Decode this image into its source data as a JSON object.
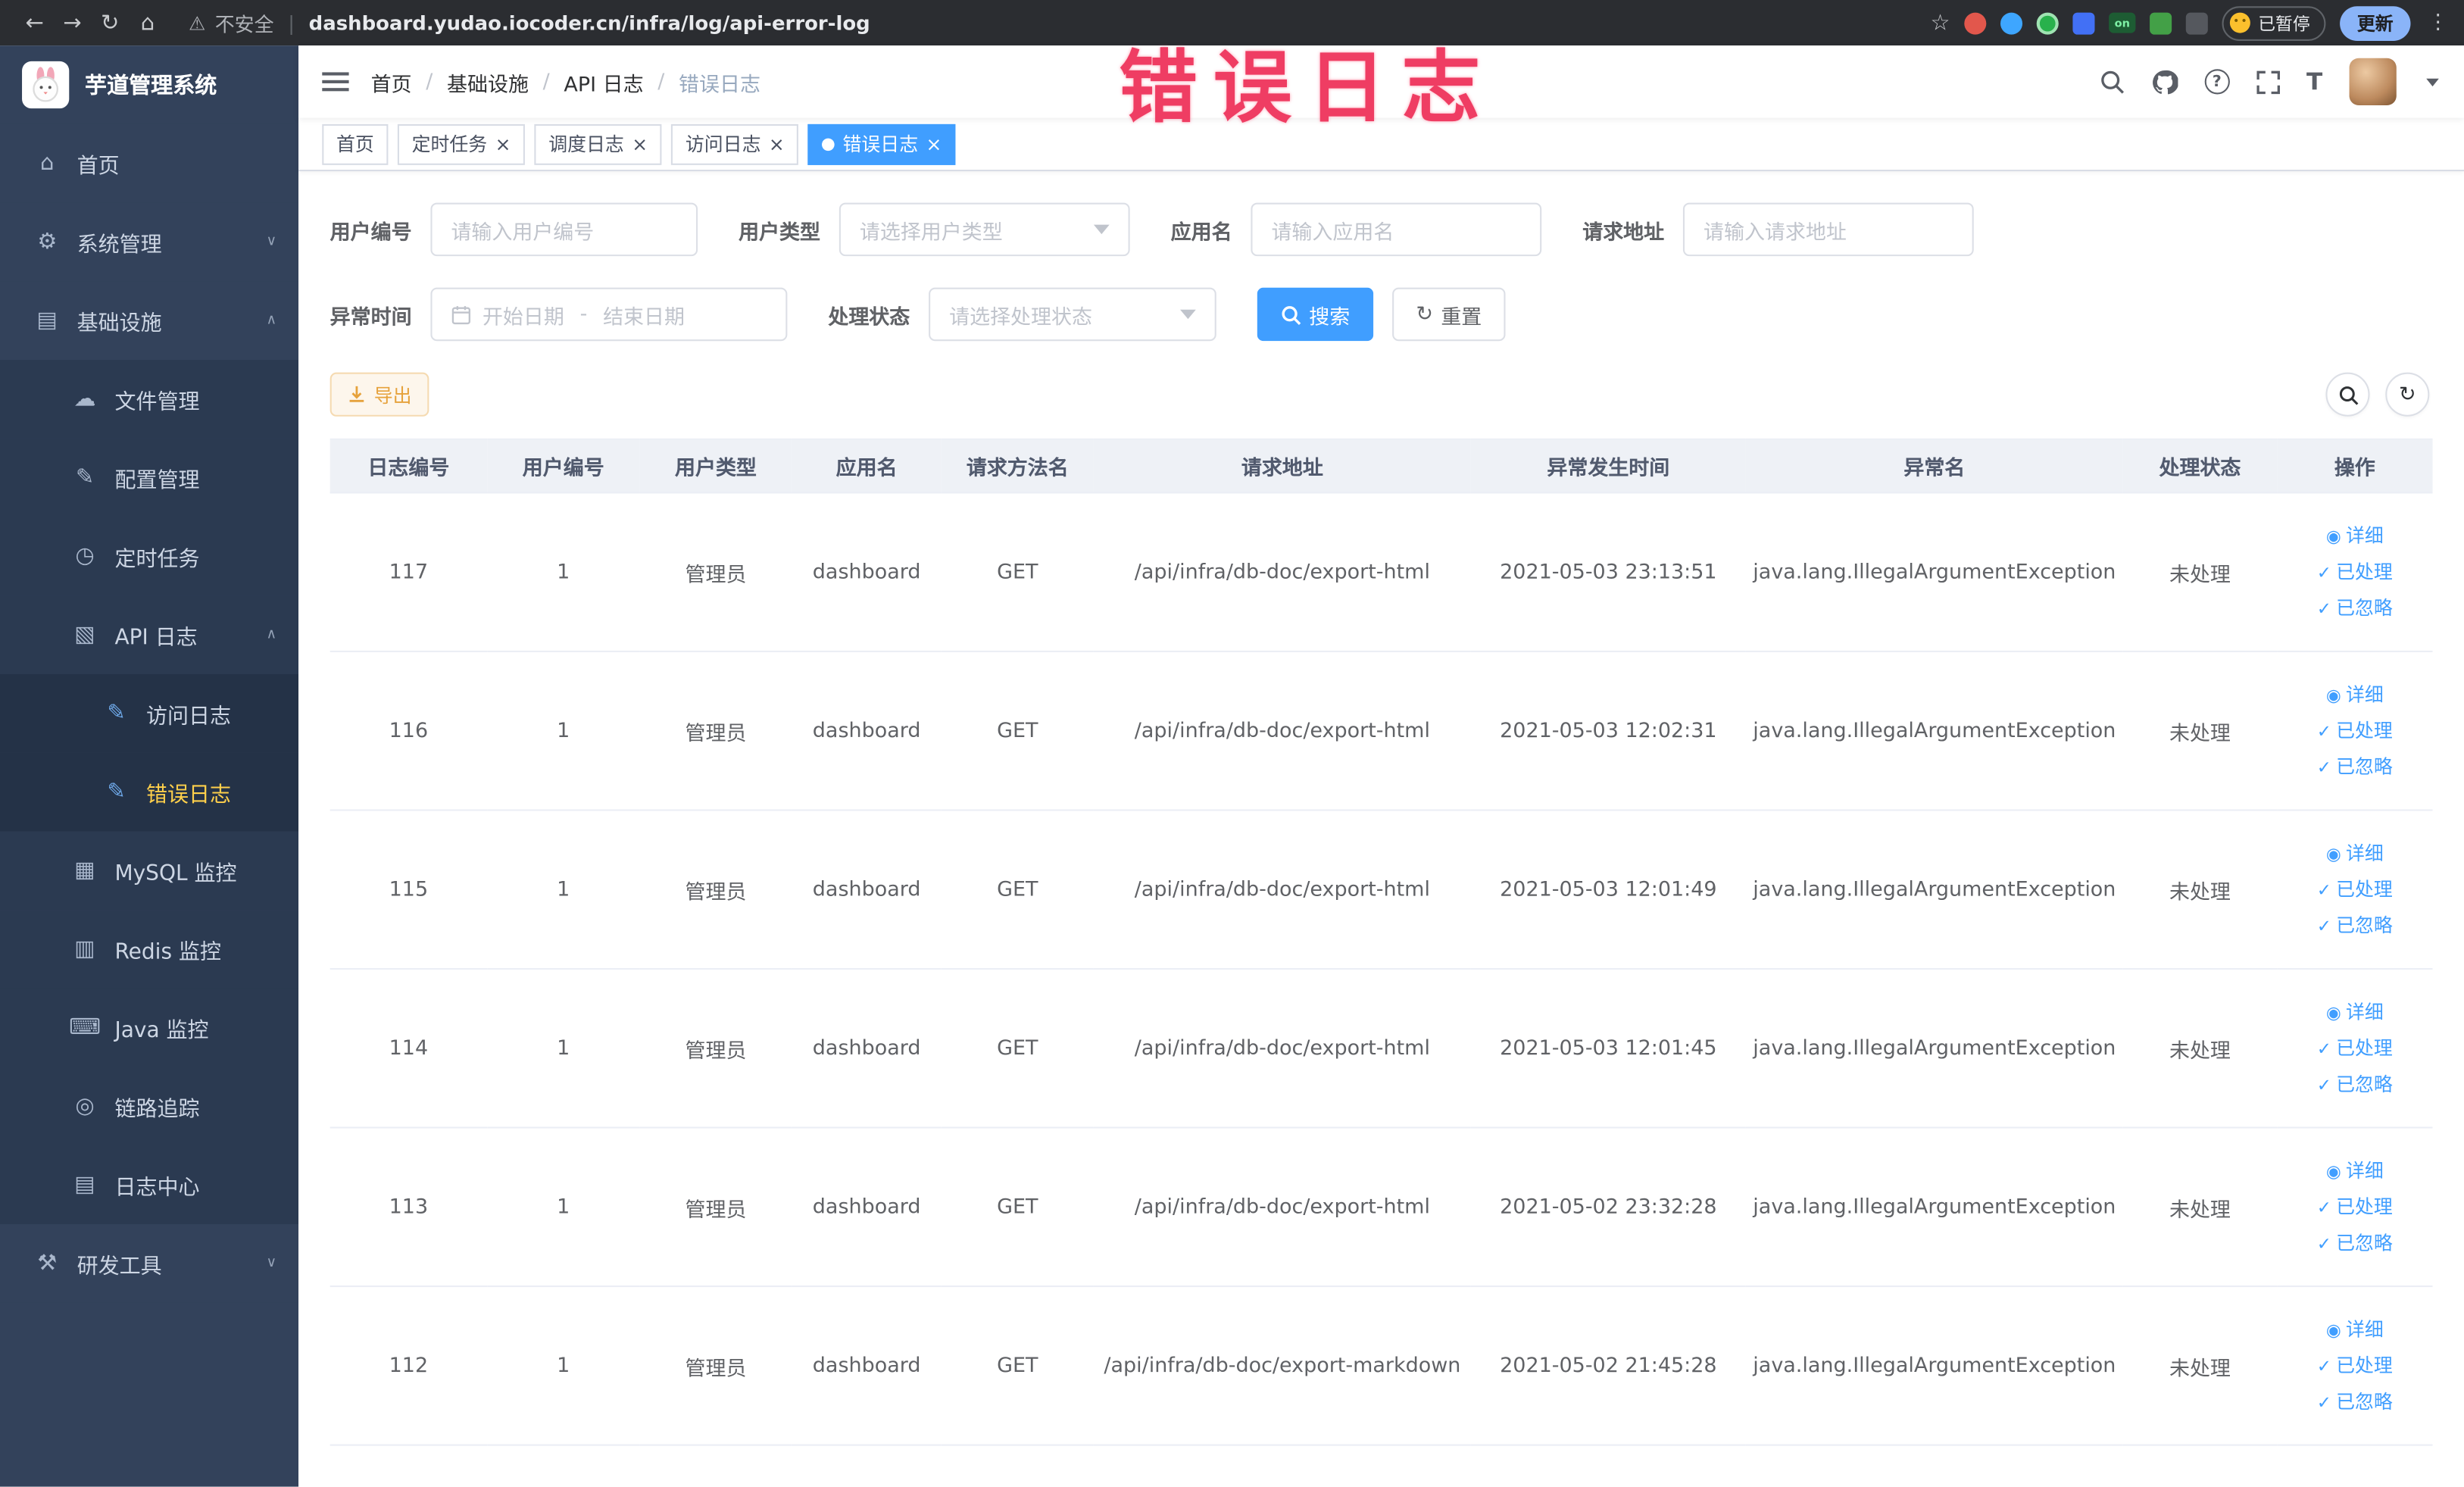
{
  "browser": {
    "security_label": "不安全",
    "url": "dashboard.yudao.iocoder.cn/infra/log/api-error-log",
    "paused_label": "已暂停",
    "update_label": "更新"
  },
  "overlay": {
    "text": "错误日志"
  },
  "sidebar": {
    "logo_title": "芋道管理系统",
    "items": [
      {
        "key": "home",
        "label": "首页",
        "icon": "home-icon",
        "level": 1
      },
      {
        "key": "system-mgmt",
        "label": "系统管理",
        "icon": "gear-icon",
        "level": 1,
        "arrow": "down"
      },
      {
        "key": "infrastructure",
        "label": "基础设施",
        "icon": "infra-icon",
        "level": 1,
        "arrow": "up"
      },
      {
        "key": "file-mgmt",
        "label": "文件管理",
        "icon": "cloud-icon",
        "level": 2
      },
      {
        "key": "config-mgmt",
        "label": "配置管理",
        "icon": "edit-icon",
        "level": 2
      },
      {
        "key": "scheduled-tasks",
        "label": "定时任务",
        "icon": "timer-icon",
        "level": 2
      },
      {
        "key": "api-log",
        "label": "API 日志",
        "icon": "api-log-icon",
        "level": 2,
        "arrow": "up"
      },
      {
        "key": "access-log",
        "label": "访问日志",
        "icon": "doc-icon",
        "level": 3
      },
      {
        "key": "error-log",
        "label": "错误日志",
        "icon": "doc-icon",
        "level": 3,
        "active": true
      },
      {
        "key": "mysql-monitor",
        "label": "MySQL 监控",
        "icon": "mysql-icon",
        "level": 2
      },
      {
        "key": "redis-monitor",
        "label": "Redis 监控",
        "icon": "redis-icon",
        "level": 2
      },
      {
        "key": "java-monitor",
        "label": "Java 监控",
        "icon": "java-icon",
        "level": 2
      },
      {
        "key": "trace",
        "label": "链路追踪",
        "icon": "trace-icon",
        "level": 2
      },
      {
        "key": "log-center",
        "label": "日志中心",
        "icon": "log-center-icon",
        "level": 2
      },
      {
        "key": "dev-tools",
        "label": "研发工具",
        "icon": "tools-icon",
        "level": 1,
        "arrow": "down"
      }
    ]
  },
  "breadcrumb": [
    "首页",
    "基础设施",
    "API 日志",
    "错误日志"
  ],
  "tabs": [
    {
      "label": "首页",
      "closable": false,
      "active": false
    },
    {
      "label": "定时任务",
      "closable": true,
      "active": false
    },
    {
      "label": "调度日志",
      "closable": true,
      "active": false
    },
    {
      "label": "访问日志",
      "closable": true,
      "active": false
    },
    {
      "label": "错误日志",
      "closable": true,
      "active": true
    }
  ],
  "filters": {
    "user_id": {
      "label": "用户编号",
      "placeholder": "请输入用户编号"
    },
    "user_type": {
      "label": "用户类型",
      "placeholder": "请选择用户类型"
    },
    "app_name": {
      "label": "应用名",
      "placeholder": "请输入应用名"
    },
    "request_url": {
      "label": "请求地址",
      "placeholder": "请输入请求地址"
    },
    "exception_time": {
      "label": "异常时间",
      "start_placeholder": "开始日期",
      "separator": "-",
      "end_placeholder": "结束日期"
    },
    "process_status": {
      "label": "处理状态",
      "placeholder": "请选择处理状态"
    },
    "search_label": "搜索",
    "reset_label": "重置"
  },
  "toolbar": {
    "export_label": "导出"
  },
  "table": {
    "columns": [
      "日志编号",
      "用户编号",
      "用户类型",
      "应用名",
      "请求方法名",
      "请求地址",
      "异常发生时间",
      "异常名",
      "处理状态",
      "操作"
    ],
    "actions": [
      "详细",
      "已处理",
      "已忽略"
    ],
    "rows": [
      {
        "id": "117",
        "user_id": "1",
        "user_type": "管理员",
        "app": "dashboard",
        "method": "GET",
        "url": "/api/infra/db-doc/export-html",
        "time": "2021-05-03 23:13:51",
        "exception": "java.lang.IllegalArgumentException",
        "status": "未处理"
      },
      {
        "id": "116",
        "user_id": "1",
        "user_type": "管理员",
        "app": "dashboard",
        "method": "GET",
        "url": "/api/infra/db-doc/export-html",
        "time": "2021-05-03 12:02:31",
        "exception": "java.lang.IllegalArgumentException",
        "status": "未处理"
      },
      {
        "id": "115",
        "user_id": "1",
        "user_type": "管理员",
        "app": "dashboard",
        "method": "GET",
        "url": "/api/infra/db-doc/export-html",
        "time": "2021-05-03 12:01:49",
        "exception": "java.lang.IllegalArgumentException",
        "status": "未处理"
      },
      {
        "id": "114",
        "user_id": "1",
        "user_type": "管理员",
        "app": "dashboard",
        "method": "GET",
        "url": "/api/infra/db-doc/export-html",
        "time": "2021-05-03 12:01:45",
        "exception": "java.lang.IllegalArgumentException",
        "status": "未处理"
      },
      {
        "id": "113",
        "user_id": "1",
        "user_type": "管理员",
        "app": "dashboard",
        "method": "GET",
        "url": "/api/infra/db-doc/export-html",
        "time": "2021-05-02 23:32:28",
        "exception": "java.lang.IllegalArgumentException",
        "status": "未处理"
      },
      {
        "id": "112",
        "user_id": "1",
        "user_type": "管理员",
        "app": "dashboard",
        "method": "GET",
        "url": "/api/infra/db-doc/export-markdown",
        "time": "2021-05-02 21:45:28",
        "exception": "java.lang.IllegalArgumentException",
        "status": "未处理"
      }
    ]
  }
}
